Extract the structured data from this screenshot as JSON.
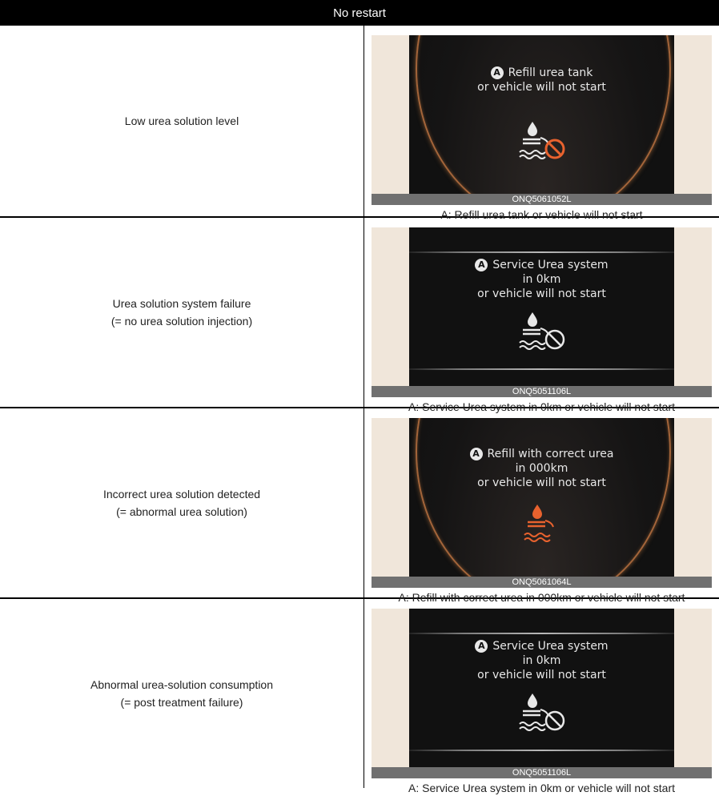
{
  "header": {
    "title": "No restart"
  },
  "rows": [
    {
      "condition_lines": [
        "Low urea solution level"
      ],
      "display": {
        "badge": "A",
        "message_lines": [
          "Refill urea tank",
          "or vehicle will not start"
        ],
        "icon": "urea-level-prohibited-icon",
        "icon_color": "#e8622e"
      },
      "image_code": "ONQ5061052L",
      "caption": "A: Refill urea tank or vehicle will not start"
    },
    {
      "condition_lines": [
        "Urea solution system failure",
        "(= no urea solution injection)"
      ],
      "display": {
        "badge": "A",
        "message_lines": [
          "Service Urea system",
          "in 0km",
          "or vehicle will not start"
        ],
        "icon": "urea-level-prohibited-icon",
        "icon_color": "#e8e8e8"
      },
      "image_code": "ONQ5051106L",
      "caption": "A: Service Urea system in 0km or vehicle will not start"
    },
    {
      "condition_lines": [
        "Incorrect urea solution detected",
        "(= abnormal urea solution)"
      ],
      "display": {
        "badge": "A",
        "message_lines": [
          "Refill with correct urea",
          "in 000km",
          "or vehicle will not start"
        ],
        "icon": "urea-level-icon",
        "icon_color": "#e8622e"
      },
      "image_code": "ONQ5061064L",
      "caption": "A: Refill with correct urea in 000km or vehicle will not start"
    },
    {
      "condition_lines": [
        "Abnormal urea-solution consumption",
        "(= post treatment failure)"
      ],
      "display": {
        "badge": "A",
        "message_lines": [
          "Service Urea system",
          "in 0km",
          "or vehicle will not start"
        ],
        "icon": "urea-level-prohibited-icon",
        "icon_color": "#e8e8e8"
      },
      "image_code": "ONQ5051106L",
      "caption": "A: Service Urea system in 0km or vehicle will not start"
    }
  ]
}
